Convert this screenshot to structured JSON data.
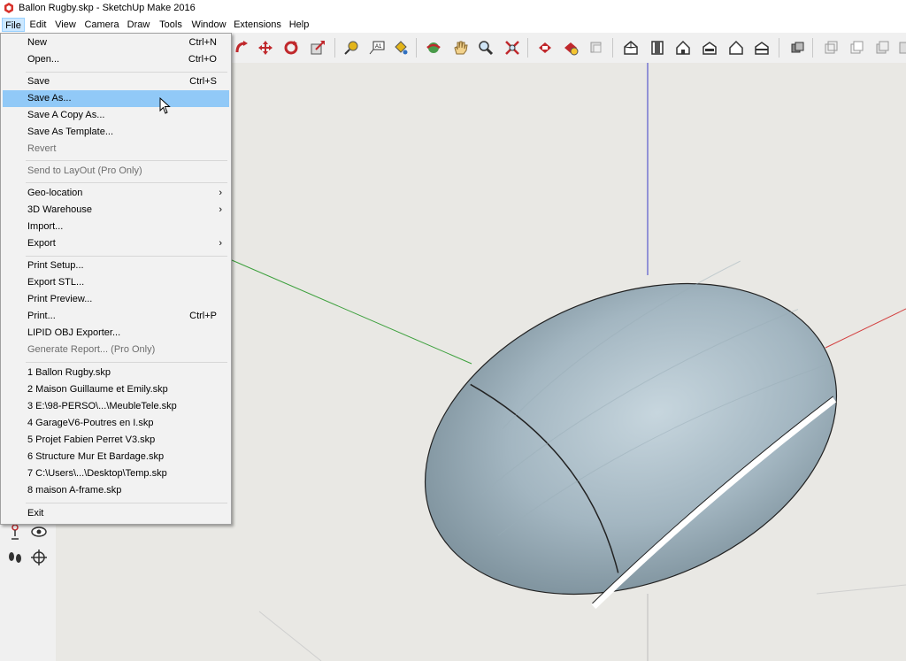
{
  "window": {
    "title": "Ballon Rugby.skp - SketchUp Make 2016"
  },
  "menubar": [
    "File",
    "Edit",
    "View",
    "Camera",
    "Draw",
    "Tools",
    "Window",
    "Extensions",
    "Help"
  ],
  "file_menu": {
    "items": [
      {
        "label": "New",
        "shortcut": "Ctrl+N"
      },
      {
        "label": "Open...",
        "shortcut": "Ctrl+O"
      },
      {
        "label": "Save",
        "shortcut": "Ctrl+S"
      },
      {
        "label": "Save As...",
        "shortcut": ""
      },
      {
        "label": "Save A Copy As...",
        "shortcut": ""
      },
      {
        "label": "Save As Template...",
        "shortcut": ""
      },
      {
        "label": "Revert",
        "shortcut": ""
      },
      {
        "label": "Send to LayOut (Pro Only)",
        "shortcut": ""
      },
      {
        "label": "Geo-location",
        "shortcut": ""
      },
      {
        "label": "3D Warehouse",
        "shortcut": ""
      },
      {
        "label": "Import...",
        "shortcut": ""
      },
      {
        "label": "Export",
        "shortcut": ""
      },
      {
        "label": "Print Setup...",
        "shortcut": ""
      },
      {
        "label": "Export STL...",
        "shortcut": ""
      },
      {
        "label": "Print Preview...",
        "shortcut": ""
      },
      {
        "label": "Print...",
        "shortcut": "Ctrl+P"
      },
      {
        "label": "LIPID OBJ Exporter...",
        "shortcut": ""
      },
      {
        "label": "Generate Report... (Pro Only)",
        "shortcut": ""
      },
      {
        "label": "1 Ballon Rugby.skp",
        "shortcut": ""
      },
      {
        "label": "2 Maison Guillaume et Emily.skp",
        "shortcut": ""
      },
      {
        "label": "3 E:\\98-PERSO\\...\\MeubleTele.skp",
        "shortcut": ""
      },
      {
        "label": "4 GarageV6-Poutres en I.skp",
        "shortcut": ""
      },
      {
        "label": "5 Projet Fabien Perret V3.skp",
        "shortcut": ""
      },
      {
        "label": "6 Structure Mur Et Bardage.skp",
        "shortcut": ""
      },
      {
        "label": "7 C:\\Users\\...\\Desktop\\Temp.skp",
        "shortcut": ""
      },
      {
        "label": "8 maison A-frame.skp",
        "shortcut": ""
      },
      {
        "label": "Exit",
        "shortcut": ""
      }
    ],
    "submenu_arrow": "›"
  },
  "colors": {
    "highlight": "#91c9f7",
    "menu_active": "#cce8ff",
    "axis_red": "#d33f3f",
    "axis_green": "#3ca03c",
    "axis_blue": "#3c3cc8",
    "model": "#a9bcc6"
  },
  "icons": {
    "toolbar": [
      "orbit-icon",
      "pan-icon",
      "zoom-icon",
      "zoom-extents-icon",
      "tape-measure-icon",
      "text-icon",
      "paint-icon",
      "move-icon",
      "rotate-icon",
      "scale-icon"
    ]
  }
}
